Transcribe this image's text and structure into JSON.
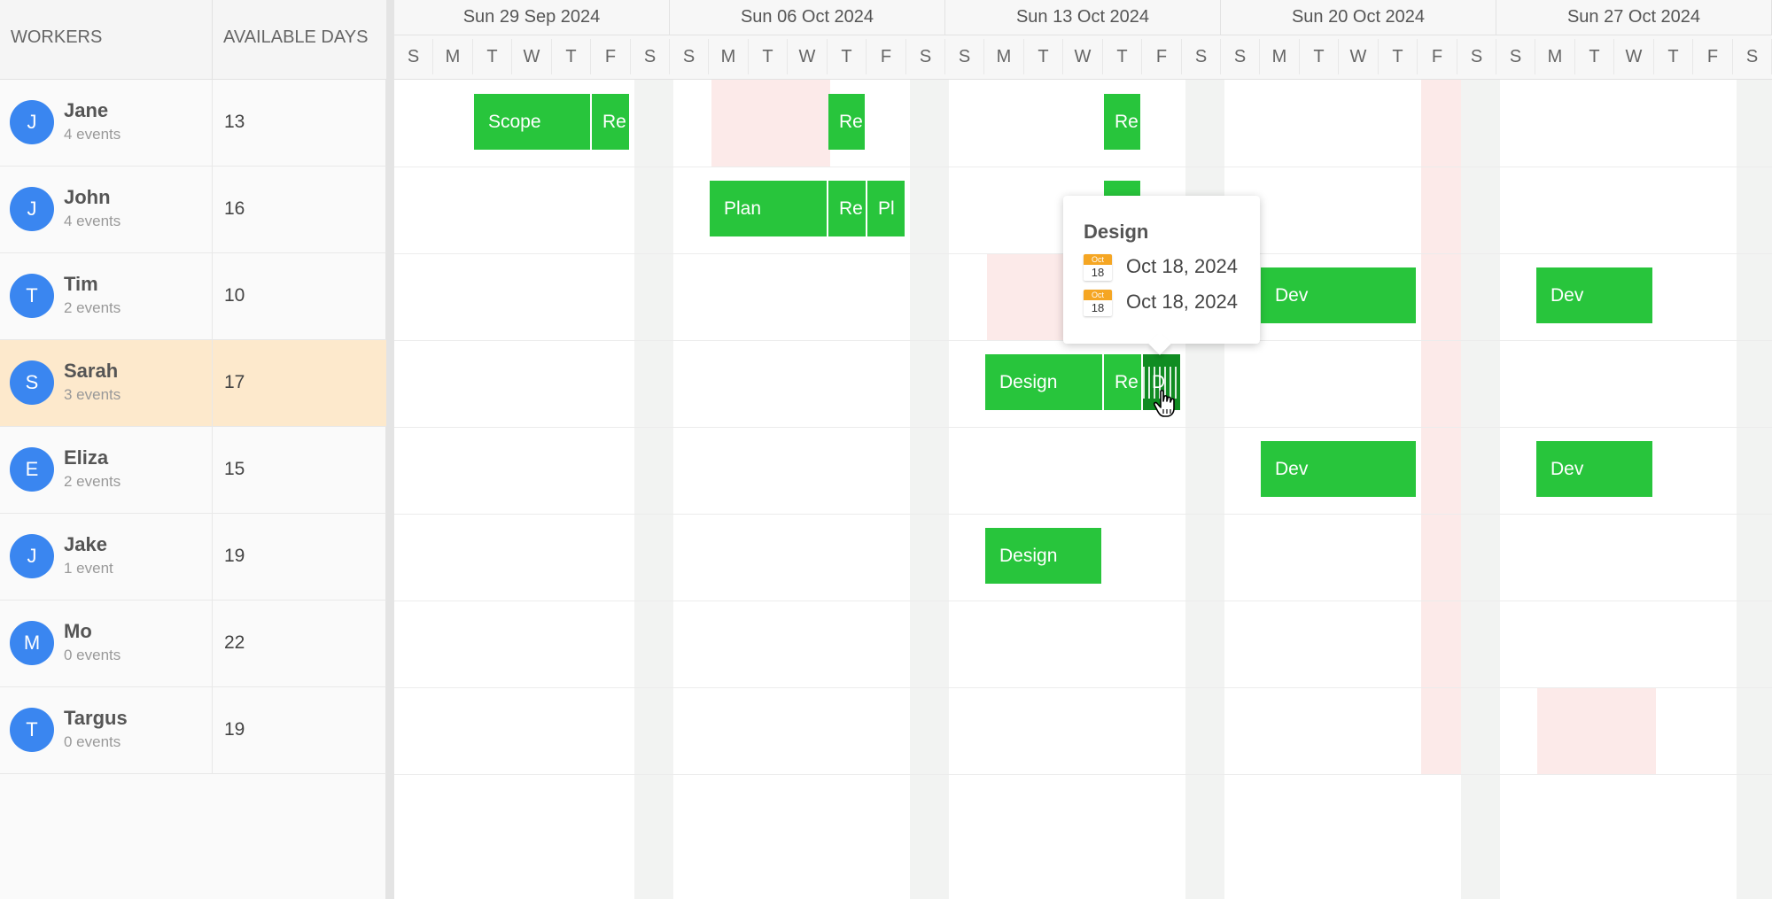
{
  "grid": {
    "workers_header": "WORKERS",
    "days_header": "AVAILABLE DAYS",
    "workers": [
      {
        "initial": "J",
        "name": "Jane",
        "events": "4 events",
        "days": "13"
      },
      {
        "initial": "J",
        "name": "John",
        "events": "4 events",
        "days": "16"
      },
      {
        "initial": "T",
        "name": "Tim",
        "events": "2 events",
        "days": "10"
      },
      {
        "initial": "S",
        "name": "Sarah",
        "events": "3 events",
        "days": "17"
      },
      {
        "initial": "E",
        "name": "Eliza",
        "events": "2 events",
        "days": "15"
      },
      {
        "initial": "J",
        "name": "Jake",
        "events": "1 event",
        "days": "19"
      },
      {
        "initial": "M",
        "name": "Mo",
        "events": "0 events",
        "days": "22"
      },
      {
        "initial": "T",
        "name": "Targus",
        "events": "0 events",
        "days": "19"
      }
    ],
    "selected_worker": "Sarah"
  },
  "timeline": {
    "weeks": [
      "Sun 29 Sep 2024",
      "Sun 06 Oct 2024",
      "Sun 13 Oct 2024",
      "Sun 20 Oct 2024",
      "Sun 27 Oct 2024"
    ],
    "day_letters": [
      "S",
      "M",
      "T",
      "W",
      "T",
      "F",
      "S"
    ]
  },
  "events": [
    {
      "worker": "Jane",
      "label": "Scope",
      "date": "Oct 1 – Oct 3, 2024"
    },
    {
      "worker": "Jane",
      "label": "Re",
      "date": "Oct 4, 2024"
    },
    {
      "worker": "Jane",
      "label": "Re",
      "date": "Oct 10, 2024"
    },
    {
      "worker": "Jane",
      "label": "Re",
      "date": "Oct 17, 2024"
    },
    {
      "worker": "John",
      "label": "Plan",
      "date": "Oct 7 – Oct 9, 2024"
    },
    {
      "worker": "John",
      "label": "Re",
      "date": "Oct 10, 2024"
    },
    {
      "worker": "John",
      "label": "Pl",
      "date": "Oct 11, 2024"
    },
    {
      "worker": "John",
      "label": "",
      "date": "Oct 17, 2024"
    },
    {
      "worker": "Tim",
      "label": "Dev",
      "date": "Oct 21 – Oct 24, 2024"
    },
    {
      "worker": "Tim",
      "label": "Dev",
      "date": "Oct 28 – Oct 30, 2024"
    },
    {
      "worker": "Sarah",
      "label": "Design",
      "date": "Oct 14 – Oct 16, 2024"
    },
    {
      "worker": "Sarah",
      "label": "Re",
      "date": "Oct 17, 2024"
    },
    {
      "worker": "Sarah",
      "label": "D",
      "date": "Oct 18, 2024"
    },
    {
      "worker": "Eliza",
      "label": "Dev",
      "date": "Oct 21 – Oct 24, 2024"
    },
    {
      "worker": "Eliza",
      "label": "Dev",
      "date": "Oct 28 – Oct 30, 2024"
    },
    {
      "worker": "Jake",
      "label": "Design",
      "date": "Oct 14 – Oct 16, 2024"
    }
  ],
  "tooltip": {
    "title": "Design",
    "start_month": "Oct",
    "start_day": "18",
    "start_date": "Oct 18, 2024",
    "end_month": "Oct",
    "end_day": "18",
    "end_date": "Oct 18, 2024"
  },
  "colors": {
    "event": "#28c53c",
    "event_active": "#108c22",
    "avatar": "#3a86f0",
    "selected_row": "#fde9cc",
    "non_working": "#fbe3e1",
    "weekend": "#f2f3f2",
    "calendar_icon": "#f5a623"
  },
  "icons": {
    "cursor": "hand-pointer-icon",
    "calendar": "calendar-icon"
  }
}
